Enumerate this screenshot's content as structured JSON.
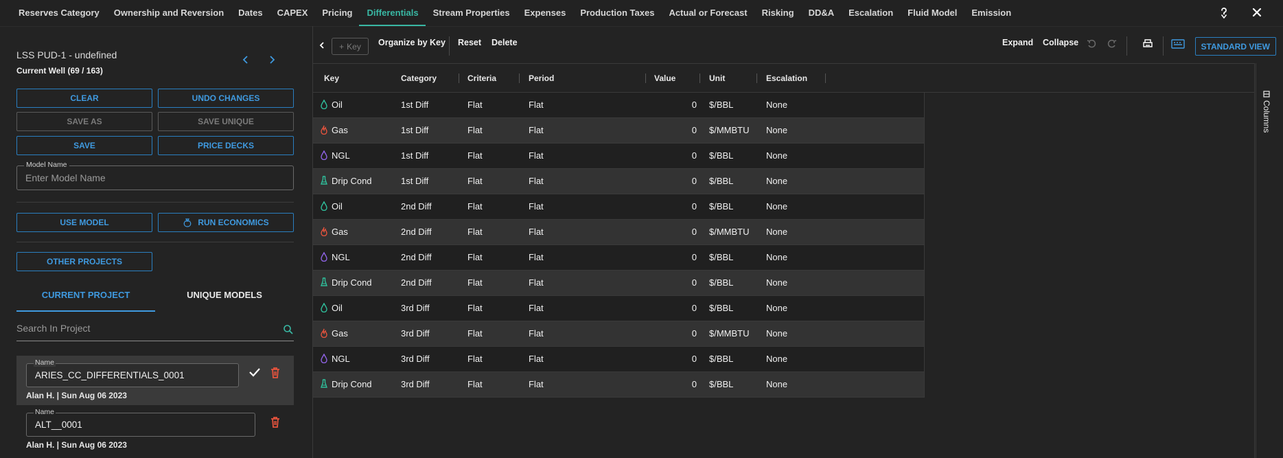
{
  "nav": {
    "tabs": [
      "Reserves Category",
      "Ownership and Reversion",
      "Dates",
      "CAPEX",
      "Pricing",
      "Differentials",
      "Stream Properties",
      "Expenses",
      "Production Taxes",
      "Actual or Forecast",
      "Risking",
      "DD&A",
      "Escalation",
      "Fluid Model",
      "Emission"
    ],
    "active_tab": "Differentials"
  },
  "left": {
    "well_title": "LSS PUD-1 - undefined",
    "well_sub": "Current Well (69 / 163)",
    "buttons": {
      "clear": "CLEAR",
      "undo": "UNDO CHANGES",
      "save_as": "SAVE AS",
      "save_unique": "SAVE UNIQUE",
      "save": "SAVE",
      "price_decks": "PRICE DECKS",
      "use_model": "USE MODEL",
      "run_economics": "RUN ECONOMICS",
      "other_projects": "OTHER PROJECTS"
    },
    "model_name_label": "Model Name",
    "model_name_placeholder": "Enter Model Name",
    "tabs": {
      "current": "CURRENT PROJECT",
      "unique": "UNIQUE MODELS"
    },
    "search_placeholder": "Search In Project",
    "models": [
      {
        "label": "Name",
        "name": "ARIES_CC_DIFFERENTIALS_0001",
        "meta": "Alan H. | Sun Aug 06 2023"
      },
      {
        "label": "Name",
        "name": "ALT__0001",
        "meta": "Alan H. | Sun Aug 06 2023"
      }
    ]
  },
  "toolbar": {
    "key": "Key",
    "organize": "Organize by Key",
    "reset": "Reset",
    "delete": "Delete",
    "expand": "Expand",
    "collapse": "Collapse",
    "standard_view": "STANDARD VIEW"
  },
  "grid": {
    "headers": [
      "Key",
      "Category",
      "Criteria",
      "Period",
      "Value",
      "Unit",
      "Escalation"
    ],
    "rows": [
      {
        "key": "Oil",
        "icon": "oil-drop-icon",
        "category": "1st Diff",
        "criteria": "Flat",
        "period": "Flat",
        "value": "0",
        "unit": "$/BBL",
        "escalation": "None"
      },
      {
        "key": "Gas",
        "icon": "gas-flame-icon",
        "category": "1st Diff",
        "criteria": "Flat",
        "period": "Flat",
        "value": "0",
        "unit": "$/MMBTU",
        "escalation": "None"
      },
      {
        "key": "NGL",
        "icon": "ngl-drop-icon",
        "category": "1st Diff",
        "criteria": "Flat",
        "period": "Flat",
        "value": "0",
        "unit": "$/BBL",
        "escalation": "None"
      },
      {
        "key": "Drip Cond",
        "icon": "drip-cond-flask-icon",
        "category": "1st Diff",
        "criteria": "Flat",
        "period": "Flat",
        "value": "0",
        "unit": "$/BBL",
        "escalation": "None"
      },
      {
        "key": "Oil",
        "icon": "oil-drop-icon",
        "category": "2nd Diff",
        "criteria": "Flat",
        "period": "Flat",
        "value": "0",
        "unit": "$/BBL",
        "escalation": "None"
      },
      {
        "key": "Gas",
        "icon": "gas-flame-icon",
        "category": "2nd Diff",
        "criteria": "Flat",
        "period": "Flat",
        "value": "0",
        "unit": "$/MMBTU",
        "escalation": "None"
      },
      {
        "key": "NGL",
        "icon": "ngl-drop-icon",
        "category": "2nd Diff",
        "criteria": "Flat",
        "period": "Flat",
        "value": "0",
        "unit": "$/BBL",
        "escalation": "None"
      },
      {
        "key": "Drip Cond",
        "icon": "drip-cond-flask-icon",
        "category": "2nd Diff",
        "criteria": "Flat",
        "period": "Flat",
        "value": "0",
        "unit": "$/BBL",
        "escalation": "None"
      },
      {
        "key": "Oil",
        "icon": "oil-drop-icon",
        "category": "3rd Diff",
        "criteria": "Flat",
        "period": "Flat",
        "value": "0",
        "unit": "$/BBL",
        "escalation": "None"
      },
      {
        "key": "Gas",
        "icon": "gas-flame-icon",
        "category": "3rd Diff",
        "criteria": "Flat",
        "period": "Flat",
        "value": "0",
        "unit": "$/MMBTU",
        "escalation": "None"
      },
      {
        "key": "NGL",
        "icon": "ngl-drop-icon",
        "category": "3rd Diff",
        "criteria": "Flat",
        "period": "Flat",
        "value": "0",
        "unit": "$/BBL",
        "escalation": "None"
      },
      {
        "key": "Drip Cond",
        "icon": "drip-cond-flask-icon",
        "category": "3rd Diff",
        "criteria": "Flat",
        "period": "Flat",
        "value": "0",
        "unit": "$/BBL",
        "escalation": "None"
      }
    ]
  },
  "side_panel": {
    "columns": "Columns"
  },
  "colors": {
    "accent_teal": "#39b8a4",
    "accent_blue": "#3f9ae0",
    "oil": "#2fbf9b",
    "gas": "#e5533d",
    "ngl": "#8f63e6",
    "drip": "#2fbf9b",
    "trash": "#e5533d"
  }
}
